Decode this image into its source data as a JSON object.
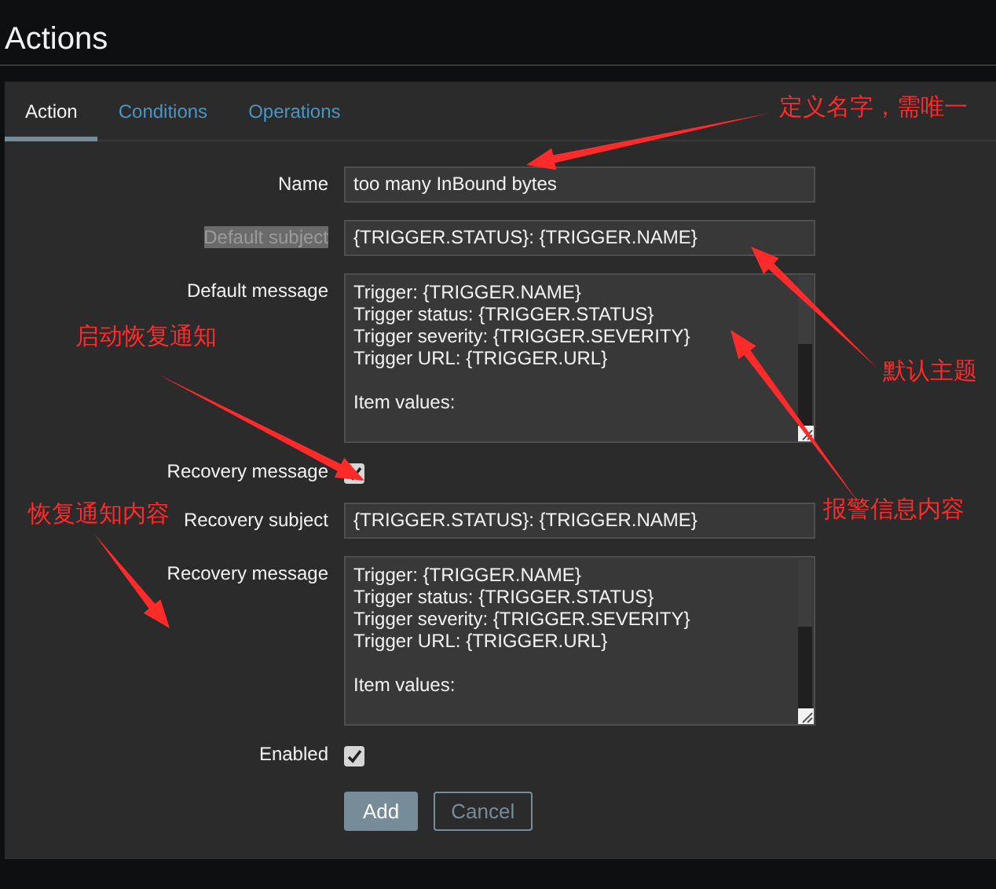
{
  "page": {
    "title": "Actions"
  },
  "tabs": [
    {
      "label": "Action",
      "selected": true
    },
    {
      "label": "Conditions",
      "selected": false
    },
    {
      "label": "Operations",
      "selected": false
    }
  ],
  "form": {
    "rows": [
      {
        "kind": "input",
        "label": "Name",
        "label_highlighted": false,
        "value": "too many InBound bytes"
      },
      {
        "kind": "input",
        "label": "Default subject",
        "label_highlighted": true,
        "value": "{TRIGGER.STATUS}: {TRIGGER.NAME}"
      },
      {
        "kind": "textarea",
        "label": "Default message",
        "label_highlighted": false,
        "value": "Trigger: {TRIGGER.NAME}\nTrigger status: {TRIGGER.STATUS}\nTrigger severity: {TRIGGER.SEVERITY}\nTrigger URL: {TRIGGER.URL}\n\nItem values:"
      },
      {
        "kind": "checkbox",
        "label": "Recovery message",
        "label_highlighted": false,
        "checked": true
      },
      {
        "kind": "input",
        "label": "Recovery subject",
        "label_highlighted": false,
        "value": "{TRIGGER.STATUS}: {TRIGGER.NAME}"
      },
      {
        "kind": "textarea",
        "label": "Recovery message",
        "label_highlighted": false,
        "value": "Trigger: {TRIGGER.NAME}\nTrigger status: {TRIGGER.STATUS}\nTrigger severity: {TRIGGER.SEVERITY}\nTrigger URL: {TRIGGER.URL}\n\nItem values:"
      },
      {
        "kind": "checkbox",
        "label": "Enabled",
        "label_highlighted": false,
        "checked": true
      }
    ]
  },
  "buttons": [
    {
      "label": "Add",
      "kind": "primary"
    },
    {
      "label": "Cancel",
      "kind": "secondary"
    }
  ],
  "annotations": [
    {
      "text": "定义名字，需唯一"
    },
    {
      "text": "启动恢复通知"
    },
    {
      "text": "默认主题"
    },
    {
      "text": "恢复通知内容"
    },
    {
      "text": "报警信息内容"
    }
  ]
}
